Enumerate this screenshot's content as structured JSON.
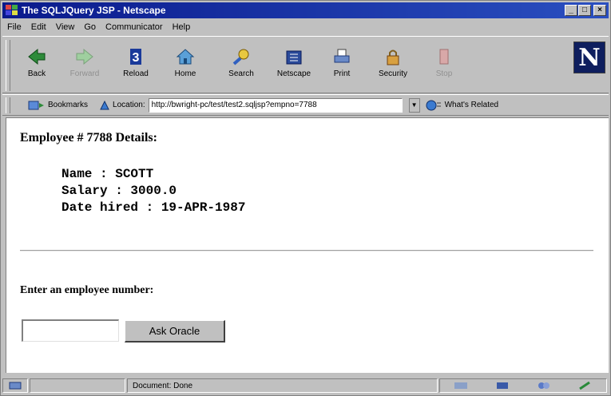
{
  "window": {
    "title": "The SQLJQuery JSP - Netscape",
    "controls": {
      "minimize": "_",
      "maximize": "□",
      "close": "×"
    }
  },
  "menu": [
    "File",
    "Edit",
    "View",
    "Go",
    "Communicator",
    "Help"
  ],
  "toolbar": {
    "buttons": [
      {
        "label": "Back",
        "icon": "back-arrow-icon",
        "enabled": true
      },
      {
        "label": "Forward",
        "icon": "forward-arrow-icon",
        "enabled": false
      },
      {
        "label": "Reload",
        "icon": "reload-icon",
        "enabled": true
      },
      {
        "label": "Home",
        "icon": "home-icon",
        "enabled": true
      },
      {
        "label": "Search",
        "icon": "search-icon",
        "enabled": true
      },
      {
        "label": "Netscape",
        "icon": "netscape-icon",
        "enabled": true
      },
      {
        "label": "Print",
        "icon": "print-icon",
        "enabled": true
      },
      {
        "label": "Security",
        "icon": "security-lock-icon",
        "enabled": true
      },
      {
        "label": "Stop",
        "icon": "stop-icon",
        "enabled": false
      }
    ],
    "logo": "N"
  },
  "location_bar": {
    "bookmarks_label": "Bookmarks",
    "location_label": "Location:",
    "url": "http://bwright-pc/test/test2.sqljsp?empno=7788",
    "related_label": "What's Related"
  },
  "page": {
    "heading": "Employee # 7788 Details:",
    "details": [
      "Name : SCOTT",
      "Salary : 3000.0",
      "Date hired : 19-APR-1987"
    ],
    "prompt": "Enter an employee number:",
    "input_value": "",
    "submit_label": "Ask Oracle"
  },
  "status": {
    "text": "Document: Done"
  },
  "colors": {
    "title_bar_start": "#0a1a8c",
    "title_bar_end": "#2a4fc0",
    "chrome": "#c0c0c0",
    "content_bg": "#ffffff"
  }
}
